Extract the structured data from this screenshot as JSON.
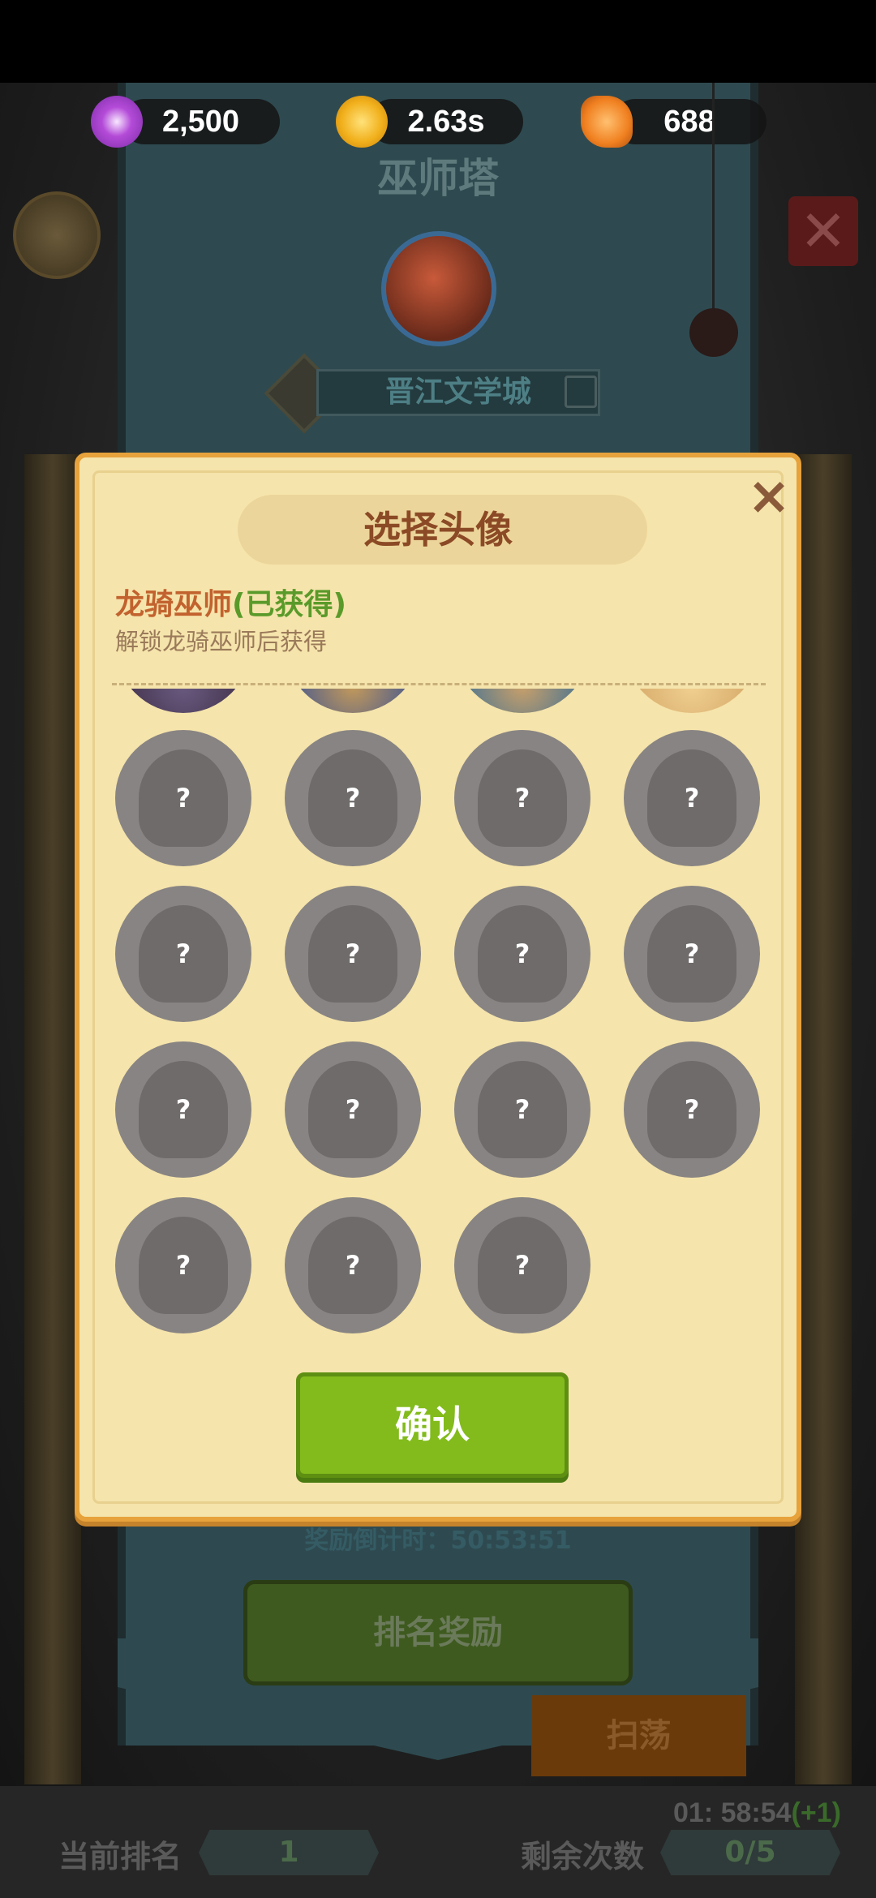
{
  "currencies": [
    {
      "icon": "purple-flower-icon",
      "value": "2,500"
    },
    {
      "icon": "gold-coin-icon",
      "value": "2.63s"
    },
    {
      "icon": "orange-gem-icon",
      "value": "688"
    }
  ],
  "tower": {
    "title": "巫师塔",
    "player_name": "晋江文学城"
  },
  "modal": {
    "title": "选择头像",
    "close_icon": "×",
    "avatar_name": "龙骑巫师",
    "avatar_status": "(已获得)",
    "avatar_desc": "解锁龙骑巫师后获得",
    "locked_mark": "?",
    "confirm_label": "确认"
  },
  "background": {
    "reward_timer_label": "奖励倒计时：",
    "reward_timer_value": "50:53:51",
    "rank_reward_label": "排名奖励",
    "sweep_label": "扫荡"
  },
  "bottom": {
    "rank_label": "当前排名",
    "rank_value": "1",
    "remaining_label": "剩余次数",
    "remaining_value": "0/5",
    "timer": "01: 58:54",
    "timer_plus": "(+1)"
  },
  "colors": {
    "modal_bg": "#f5e4ab",
    "modal_border": "#e7a23b",
    "confirm_green": "#82bb1b",
    "locked_slot": "#888483"
  }
}
